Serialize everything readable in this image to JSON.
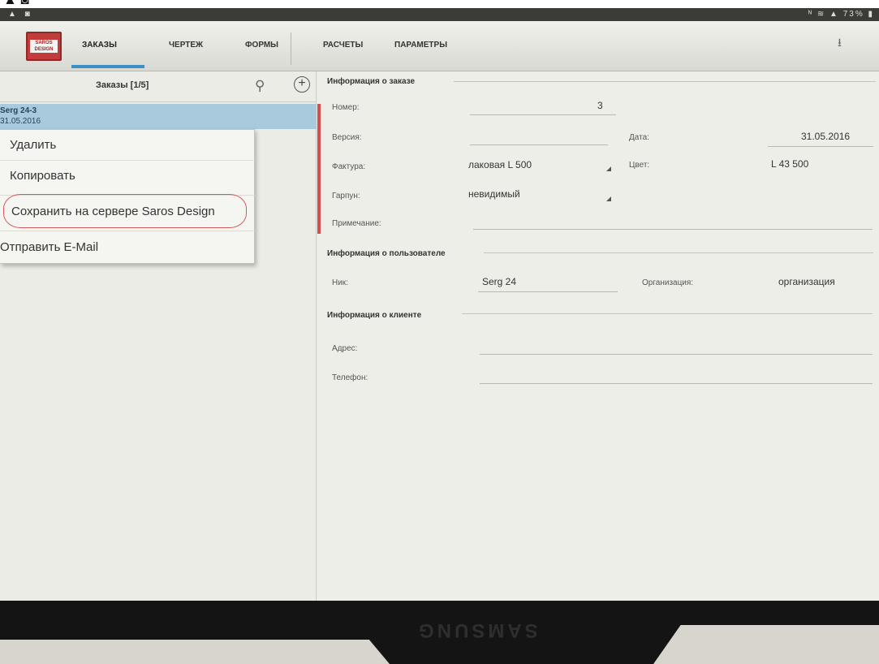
{
  "statusbar": {
    "left_icons": "▲ ◙",
    "right_icons": "ᴺ ≋ ▲ 73% ▮"
  },
  "header": {
    "logo_text": "SAROS DESIGN",
    "tabs": [
      {
        "label": "ЗАКАЗЫ"
      },
      {
        "label": "ЧЕРТЕЖ"
      },
      {
        "label": "ФОРМЫ"
      },
      {
        "label": "РАСЧЕТЫ"
      },
      {
        "label": "ПАРАМЕТРЫ"
      }
    ],
    "download_icon": "⭳"
  },
  "orders_list": {
    "title": "Заказы [1/5]",
    "search_icon": "⚲",
    "add_icon": "+",
    "selected": {
      "name": "Serg 24-3",
      "date": "31.05.2016"
    }
  },
  "context_menu": {
    "items": [
      {
        "label": "Удалить"
      },
      {
        "label": "Копировать"
      },
      {
        "label": "Сохранить на сервере Saros Design"
      },
      {
        "label": "Отправить E-Mail"
      }
    ]
  },
  "order_info": {
    "section_title": "Информация о заказе",
    "number_label": "Номер:",
    "number_value": "3",
    "version_label": "Версия:",
    "version_value": "",
    "date_label": "Дата:",
    "date_value": "31.05.2016",
    "texture_label": "Фактура:",
    "texture_value": "лаковая L 500",
    "color_label": "Цвет:",
    "color_value": "L 43 500",
    "harpoon_label": "Гарпун:",
    "harpoon_value": "невидимый",
    "note_label": "Примечание:"
  },
  "user_info": {
    "section_title": "Информация о пользователе",
    "nick_label": "Ник:",
    "nick_value": "Serg 24",
    "org_label": "Организация:",
    "org_value": "организация"
  },
  "client_info": {
    "section_title": "Информация о клиенте",
    "address_label": "Адрес:",
    "phone_label": "Телефон:"
  },
  "device": {
    "brand": "SAMSUNG"
  }
}
